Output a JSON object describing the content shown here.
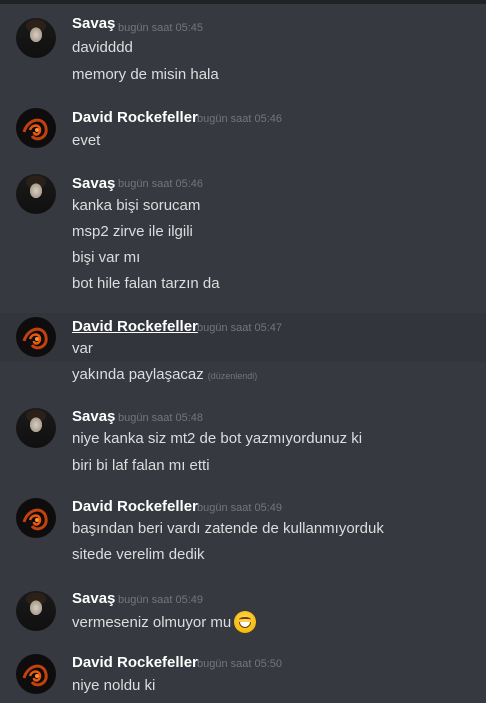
{
  "messages": [
    {
      "author": "Savaş",
      "timestamp": "bugün saat 05:45",
      "avatar": "savas",
      "lines": [
        "davidddd",
        "memory de misin hala"
      ]
    },
    {
      "author": "David Rockefeller",
      "timestamp": "bugün saat 05:46",
      "avatar": "david",
      "lines": [
        "evet"
      ]
    },
    {
      "author": "Savaş",
      "timestamp": "bugün saat 05:46",
      "avatar": "savas",
      "lines": [
        "kanka bişi sorucam",
        "msp2 zirve ile ilgili",
        "bişi var mı",
        "bot hile falan tarzın da"
      ]
    },
    {
      "author": "David Rockefeller",
      "timestamp": "bugün saat 05:47",
      "avatar": "david",
      "lines": [
        "var",
        "yakında paylaşacaz"
      ],
      "edited_label": "(düzenlendi)"
    },
    {
      "author": "Savaş",
      "timestamp": "bugün saat 05:48",
      "avatar": "savas",
      "lines": [
        "niye kanka siz mt2 de bot yazmıyordunuz ki",
        "biri bi laf falan mı etti"
      ]
    },
    {
      "author": "David Rockefeller",
      "timestamp": "bugün saat 05:49",
      "avatar": "david",
      "lines": [
        "başından beri vardı zatende de kullanmıyorduk",
        "sitede verelim dedik"
      ]
    },
    {
      "author": "Savaş",
      "timestamp": "bugün saat 05:49",
      "avatar": "savas",
      "lines": [
        "vermeseniz olmuyor mu"
      ],
      "emoji": "grinning-face-emoji"
    },
    {
      "author": "David Rockefeller",
      "timestamp": "bugün saat 05:50",
      "avatar": "david",
      "lines": [
        "niye noldu ki"
      ]
    }
  ]
}
